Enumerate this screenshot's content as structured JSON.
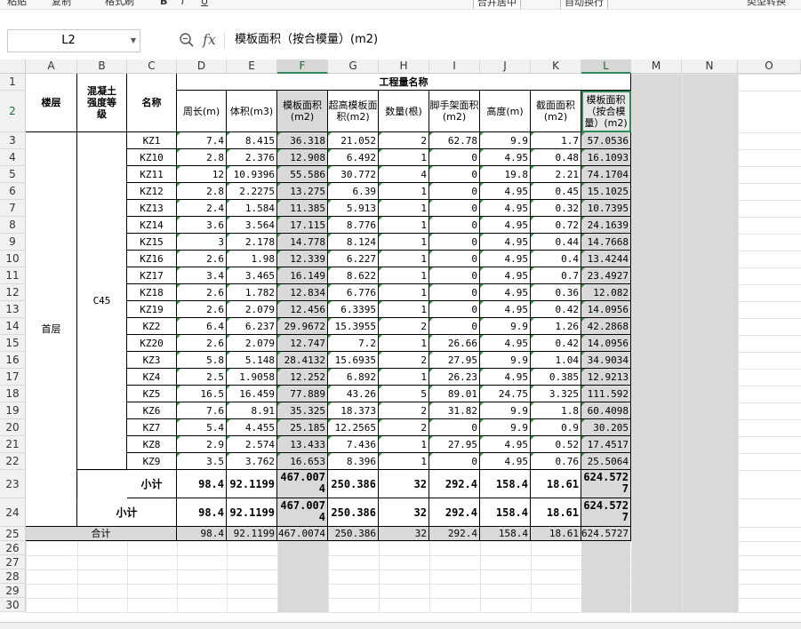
{
  "toolbar": {
    "paste": "粘贴",
    "copy": "复制",
    "format_painter": "格式刷",
    "merge": "合并居中",
    "wrap": "自动换行",
    "convert": "类型转换",
    "font_buttons": [
      "B",
      "I",
      "U"
    ]
  },
  "namebox": {
    "ref": "L2"
  },
  "formula": {
    "fx": "fx",
    "text": "模板面积（按合模量）(m2)"
  },
  "columns": [
    "A",
    "B",
    "C",
    "D",
    "E",
    "F",
    "G",
    "H",
    "I",
    "J",
    "K",
    "L",
    "M",
    "N",
    "O"
  ],
  "rows": [
    "1",
    "2",
    "3",
    "4",
    "5",
    "6",
    "7",
    "8",
    "9",
    "10",
    "11",
    "12",
    "13",
    "14",
    "15",
    "16",
    "17",
    "18",
    "19",
    "20",
    "21",
    "22",
    "23",
    "24",
    "25",
    "26",
    "27",
    "28",
    "29",
    "30"
  ],
  "headers": {
    "floor": "楼层",
    "concrete": "混凝土强度等级",
    "name": "名称",
    "group": "工程量名称",
    "perimeter": "周长(m)",
    "volume": "体积(m3)",
    "formwork": "模板面积(m2)",
    "super_formwork": "超高模板面积(m2)",
    "count": "数量(根)",
    "scaffold": "脚手架面积(m2)",
    "height": "高度(m)",
    "section": "截面面积(m2)",
    "formwork_mold": "模板面积（按合模量）(m2)"
  },
  "floor": "首层",
  "concrete_grade": "C45",
  "data_rows": [
    [
      "KZ1",
      "7.4",
      "8.415",
      "36.318",
      "21.052",
      "2",
      "62.78",
      "9.9",
      "1.7",
      "57.0536"
    ],
    [
      "KZ10",
      "2.8",
      "2.376",
      "12.908",
      "6.492",
      "1",
      "0",
      "4.95",
      "0.48",
      "16.1093"
    ],
    [
      "KZ11",
      "12",
      "10.9396",
      "55.586",
      "30.772",
      "4",
      "0",
      "19.8",
      "2.21",
      "74.1704"
    ],
    [
      "KZ12",
      "2.8",
      "2.2275",
      "13.275",
      "6.39",
      "1",
      "0",
      "4.95",
      "0.45",
      "15.1025"
    ],
    [
      "KZ13",
      "2.4",
      "1.584",
      "11.385",
      "5.913",
      "1",
      "0",
      "4.95",
      "0.32",
      "10.7395"
    ],
    [
      "KZ14",
      "3.6",
      "3.564",
      "17.115",
      "8.776",
      "1",
      "0",
      "4.95",
      "0.72",
      "24.1639"
    ],
    [
      "KZ15",
      "3",
      "2.178",
      "14.778",
      "8.124",
      "1",
      "0",
      "4.95",
      "0.44",
      "14.7668"
    ],
    [
      "KZ16",
      "2.6",
      "1.98",
      "12.339",
      "6.227",
      "1",
      "0",
      "4.95",
      "0.4",
      "13.4244"
    ],
    [
      "KZ17",
      "3.4",
      "3.465",
      "16.149",
      "8.622",
      "1",
      "0",
      "4.95",
      "0.7",
      "23.4927"
    ],
    [
      "KZ18",
      "2.6",
      "1.782",
      "12.834",
      "6.776",
      "1",
      "0",
      "4.95",
      "0.36",
      "12.082"
    ],
    [
      "KZ19",
      "2.6",
      "2.079",
      "12.456",
      "6.3395",
      "1",
      "0",
      "4.95",
      "0.42",
      "14.0956"
    ],
    [
      "KZ2",
      "6.4",
      "6.237",
      "29.9672",
      "15.3955",
      "2",
      "0",
      "9.9",
      "1.26",
      "42.2868"
    ],
    [
      "KZ20",
      "2.6",
      "2.079",
      "12.747",
      "7.2",
      "1",
      "26.66",
      "4.95",
      "0.42",
      "14.0956"
    ],
    [
      "KZ3",
      "5.8",
      "5.148",
      "28.4132",
      "15.6935",
      "2",
      "27.95",
      "9.9",
      "1.04",
      "34.9034"
    ],
    [
      "KZ4",
      "2.5",
      "1.9058",
      "12.252",
      "6.892",
      "1",
      "26.23",
      "4.95",
      "0.385",
      "12.9213"
    ],
    [
      "KZ5",
      "16.5",
      "16.459",
      "77.889",
      "43.26",
      "5",
      "89.01",
      "24.75",
      "3.325",
      "111.592"
    ],
    [
      "KZ6",
      "7.6",
      "8.91",
      "35.325",
      "18.373",
      "2",
      "31.82",
      "9.9",
      "1.8",
      "60.4098"
    ],
    [
      "KZ7",
      "5.4",
      "4.455",
      "25.185",
      "12.2565",
      "2",
      "0",
      "9.9",
      "0.9",
      "30.205"
    ],
    [
      "KZ8",
      "2.9",
      "2.574",
      "13.433",
      "7.436",
      "1",
      "27.95",
      "4.95",
      "0.52",
      "17.4517"
    ],
    [
      "KZ9",
      "3.5",
      "3.762",
      "16.653",
      "8.396",
      "1",
      "0",
      "4.95",
      "0.76",
      "25.5064"
    ]
  ],
  "subtotal1": {
    "label": "小计",
    "values": [
      "98.4",
      "92.1199",
      "467.0074",
      "250.386",
      "32",
      "292.4",
      "158.4",
      "18.61",
      "624.5727"
    ]
  },
  "subtotal2": {
    "label": "小计",
    "values": [
      "98.4",
      "92.1199",
      "467.0074",
      "250.386",
      "32",
      "292.4",
      "158.4",
      "18.61",
      "624.5727"
    ]
  },
  "total": {
    "label": "合计",
    "values": [
      "98.4",
      "92.1199",
      "467.0074",
      "250.386",
      "32",
      "292.4",
      "158.4",
      "18.61",
      "624.5727"
    ]
  },
  "colors": {
    "accent": "#2e8b57",
    "shade": "#d9d9d9"
  }
}
